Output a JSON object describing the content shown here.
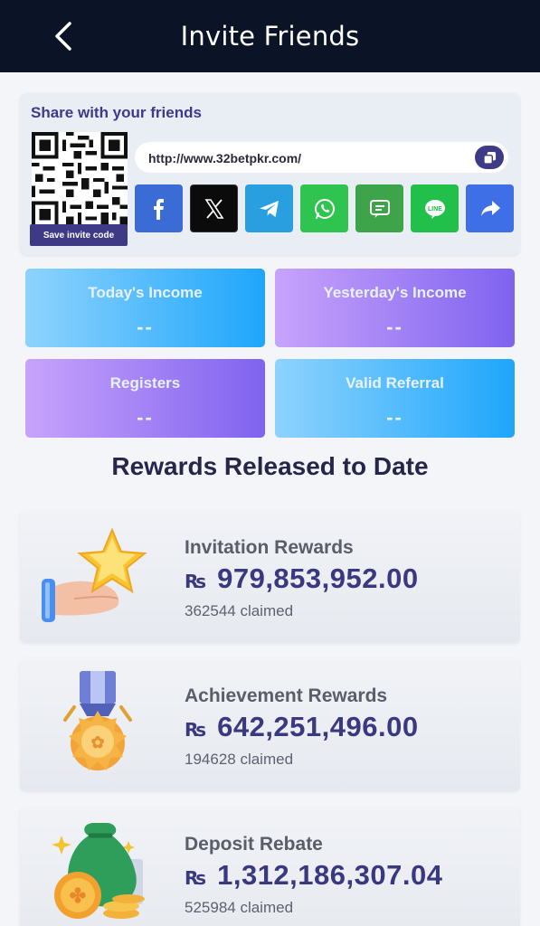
{
  "header": {
    "title": "Invite Friends"
  },
  "share": {
    "label": "Share with your friends",
    "save_invite_code": "Save invite code",
    "link": "http://www.32betpkr.com/",
    "socials": [
      {
        "name": "facebook",
        "color": "#3b6cd6"
      },
      {
        "name": "x",
        "color": "#0b0b0b"
      },
      {
        "name": "telegram",
        "color": "#2a9fe0"
      },
      {
        "name": "whatsapp",
        "color": "#2fc44f"
      },
      {
        "name": "sms",
        "color": "#3ea44a"
      },
      {
        "name": "line",
        "color": "#20c04a"
      },
      {
        "name": "share",
        "color": "#3f6fe6"
      }
    ]
  },
  "stats": {
    "today_income": {
      "label": "Today's Income",
      "value": "--"
    },
    "yesterday_income": {
      "label": "Yesterday's Income",
      "value": "--"
    },
    "registers": {
      "label": "Registers",
      "value": "--"
    },
    "valid_referral": {
      "label": "Valid Referral",
      "value": "--"
    }
  },
  "rewards_title": "Rewards Released to Date",
  "rewards": [
    {
      "name": "Invitation Rewards",
      "currency": "₨",
      "amount": "979,853,952.00",
      "claimed": "362544 claimed",
      "icon": "star-hand-icon"
    },
    {
      "name": "Achievement Rewards",
      "currency": "₨",
      "amount": "642,251,496.00",
      "claimed": "194628 claimed",
      "icon": "medal-icon"
    },
    {
      "name": "Deposit Rebate",
      "currency": "₨",
      "amount": "1,312,186,307.04",
      "claimed": "525984 claimed",
      "icon": "money-bag-icon"
    }
  ]
}
